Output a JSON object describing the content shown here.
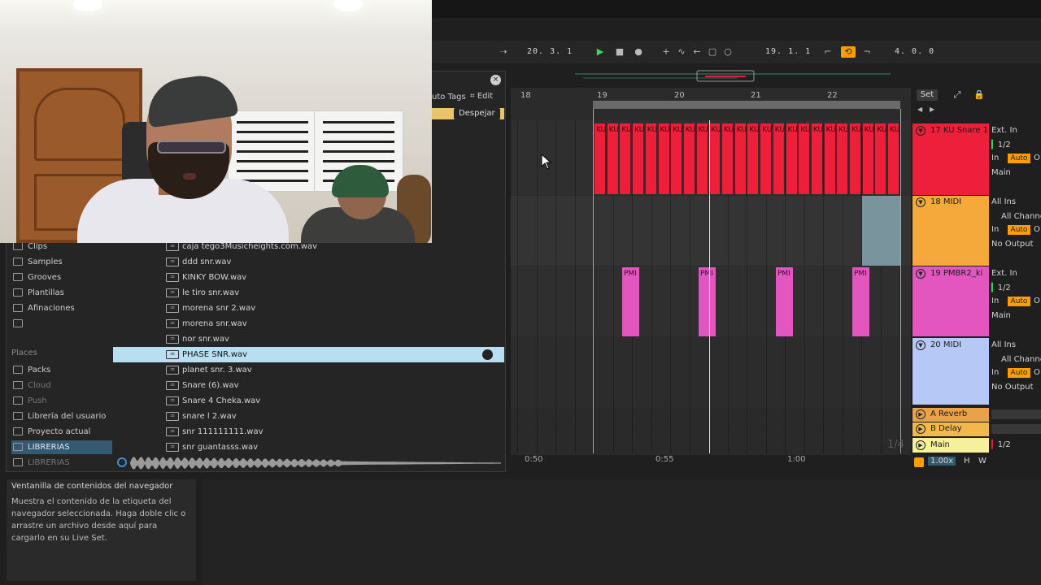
{
  "transport": {
    "position_left": "20.  3.  1",
    "position_center": "19.  1.  1",
    "position_right": "4.  0.  0"
  },
  "browser": {
    "autotags_label": "uto Tags",
    "edit_label": "Edit",
    "clear_label": "Despejar",
    "close_label": "×",
    "categories": [
      {
        "label": "Clips"
      },
      {
        "label": "Samples"
      },
      {
        "label": "Grooves"
      },
      {
        "label": "Plantillas"
      },
      {
        "label": "Afinaciones"
      }
    ],
    "places_header": "Places",
    "places": [
      {
        "label": "Packs",
        "state": "normal"
      },
      {
        "label": "Cloud",
        "state": "dim"
      },
      {
        "label": "Push",
        "state": "dim"
      },
      {
        "label": "Librería del usuario",
        "state": "normal"
      },
      {
        "label": "Proyecto actual",
        "state": "normal"
      },
      {
        "label": "LIBRERIAS",
        "state": "selected"
      },
      {
        "label": "LIBRERIAS",
        "state": "dim"
      }
    ],
    "files": [
      {
        "name": "caja tego3Musicheights.com.wav"
      },
      {
        "name": "ddd snr.wav"
      },
      {
        "name": "KINKY BOW.wav"
      },
      {
        "name": "le tiro snr.wav"
      },
      {
        "name": "morena snr 2.wav"
      },
      {
        "name": "morena snr.wav"
      },
      {
        "name": "nor snr.wav"
      },
      {
        "name": "PHASE SNR.wav",
        "selected": true
      },
      {
        "name": "planet snr. 3.wav"
      },
      {
        "name": "Snare (6).wav"
      },
      {
        "name": "Snare 4 Cheka.wav"
      },
      {
        "name": "snare l 2.wav"
      },
      {
        "name": "snr 111111111.wav"
      },
      {
        "name": "snr guantasss.wav"
      }
    ]
  },
  "info": {
    "title": "Ventanilla de contenidos del navegador",
    "body": "Muestra el contenido de la etiqueta del navegador seleccionada. Haga doble clic o arrastre un archivo desde aquí para cargarlo en su Live Set."
  },
  "arrangement": {
    "ruler": [
      "18",
      "19",
      "20",
      "21",
      "22"
    ],
    "time_marks": [
      "0:50",
      "0:55",
      "1:00"
    ],
    "fraction": "1/4",
    "set_label": "Set",
    "clip_kick_label": "KU",
    "clip_pmb_label": "PMI"
  },
  "tracks": [
    {
      "name": "17 KU Snare 1",
      "color": "#ee1f3a",
      "input": "Ext. In",
      "channel": "1/2",
      "in": "In",
      "auto": "Auto",
      "out": "O",
      "output": "Main"
    },
    {
      "name": "18 MIDI",
      "color": "#f4a93a",
      "input": "All Ins",
      "channel": "All Channe",
      "in": "In",
      "auto": "Auto",
      "out": "O",
      "output": "No Output"
    },
    {
      "name": "19 PMBR2_ki",
      "color": "#e356c0",
      "input": "Ext. In",
      "channel": "1/2",
      "in": "In",
      "auto": "Auto",
      "out": "O",
      "output": "Main"
    },
    {
      "name": "20 MIDI",
      "color": "#b6c8f5",
      "input": "All Ins",
      "channel": "All Channe",
      "in": "In",
      "auto": "Auto",
      "out": "O",
      "output": "No Output"
    }
  ],
  "returns": [
    {
      "name": "A Reverb",
      "color": "#e8a24a"
    },
    {
      "name": "B Delay",
      "color": "#f2b84a"
    },
    {
      "name": "Main",
      "color": "#f5f09a",
      "value": "1/2"
    }
  ],
  "footer": {
    "zoom": "1.00x",
    "h_label": "H",
    "w_label": "W"
  }
}
